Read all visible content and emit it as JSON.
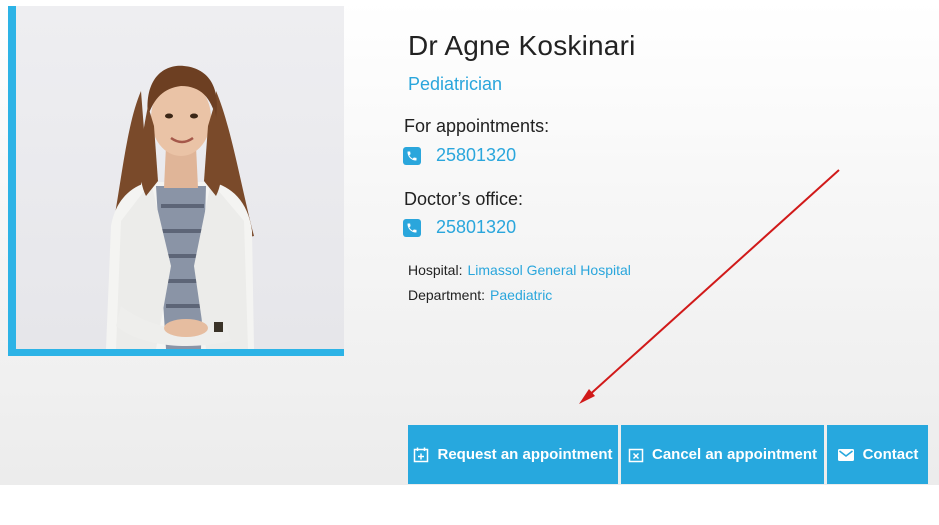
{
  "doctor": {
    "name": "Dr Agne Koskinari",
    "specialty": "Pediatrician"
  },
  "appointments": {
    "label": "For appointments:",
    "phone": "25801320"
  },
  "office": {
    "label": "Doctor’s office:",
    "phone": "25801320"
  },
  "hospital": {
    "label": "Hospital:",
    "value": "Limassol General Hospital"
  },
  "department": {
    "label": "Department:",
    "value": "Paediatric"
  },
  "actions": {
    "request_label": "Request an appointment",
    "cancel_label": "Cancel an appointment",
    "contact_label": "Contact"
  },
  "colors": {
    "accent": "#27a8de",
    "annotation_arrow": "#d11a1a"
  }
}
